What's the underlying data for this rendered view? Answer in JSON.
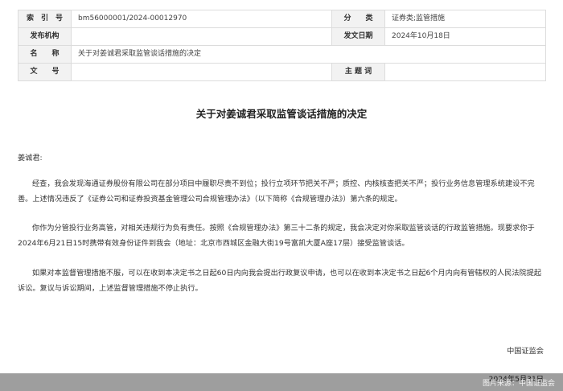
{
  "meta": {
    "index_label": "索　引　号",
    "index_value": "bm56000001/2024-00012970",
    "category_label": "分　　类",
    "category_value": "证券类;监管措施",
    "issuer_label": "发布机构",
    "issuer_value": "",
    "date_label": "发文日期",
    "date_value": "2024年10月18日",
    "name_label": "名　　称",
    "name_value": "关于对姜诚君采取监管谈话措施的决定",
    "docno_label": "文　　号",
    "docno_value": "",
    "subject_label": "主 题 词",
    "subject_value": ""
  },
  "document": {
    "title": "关于对姜诚君采取监管谈话措施的决定",
    "salutation": "姜诚君:",
    "paragraphs": [
      "经查，我会发现海通证券股份有限公司在部分项目中履职尽责不到位；投行立项环节把关不严；质控、内核核查把关不严；投行业务信息管理系统建设不完善。上述情况违反了《证券公司和证券投资基金管理公司合规管理办法》（以下简称《合规管理办法》）第六条的规定。",
      "你作为分管投行业务高管，对相关违规行为负有责任。按照《合规管理办法》第三十二条的规定，我会决定对你采取监管谈话的行政监管措施。现要求你于2024年6月21日15时携带有效身份证件到我会（地址：北京市西城区金融大街19号富凯大厦A座17层）接受监管谈话。",
      "如果对本监督管理措施不服，可以在收到本决定书之日起60日内向我会提出行政复议申请，也可以在收到本决定书之日起6个月内向有管辖权的人民法院提起诉讼。复议与诉讼期间，上述监督管理措施不停止执行。"
    ],
    "signer": "中国证监会",
    "sign_date": "2024年5月31日"
  },
  "watermark": {
    "credit": "图片来源：中国证监会"
  }
}
